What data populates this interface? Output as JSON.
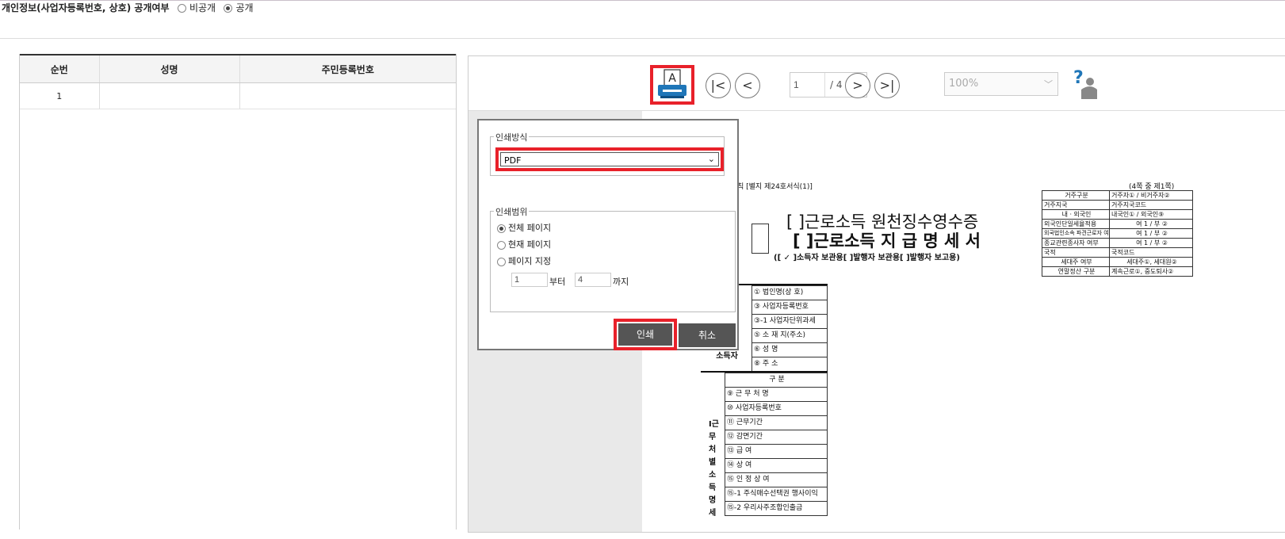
{
  "top": {
    "title": "개인정보(사업자등록번호, 상호) 공개여부",
    "opt_private": "비공개",
    "opt_public": "공개"
  },
  "table": {
    "headers": [
      "순번",
      "성명",
      "주민등록번호"
    ],
    "rows": [
      [
        "1",
        "",
        ""
      ]
    ]
  },
  "viewer": {
    "page_current": "1",
    "page_total": "/ 4",
    "zoom": "100%",
    "print_icon_letter": "A"
  },
  "dialog": {
    "method_legend": "인쇄방식",
    "method_value": "PDF",
    "range_legend": "인쇄범위",
    "opt_all": "전체 페이지",
    "opt_current": "현재 페이지",
    "opt_range": "페이지 지정",
    "from_value": "1",
    "from_label": "부터",
    "to_value": "4",
    "to_label": "까지",
    "print_label": "인쇄",
    "cancel_label": "취소"
  },
  "document": {
    "rule_ref": "칙 [별지 제24호서식(1)]",
    "page_note": "(4쪽 중 제1쪽)",
    "title1": "[  ]근로소득 원천징수영수증",
    "title2": "[  ]근로소득 지 급 명 세 서",
    "subtitle": "([ ✓ ]소득자 보관용[     ]발행자 보관용[     ]발행자 보고용)",
    "right_rows": [
      [
        "거주구분",
        "거주자① / 비거주자②"
      ],
      [
        "거주지국",
        "거주지국코드"
      ],
      [
        "내ㆍ외국인",
        "내국인① / 외국인⑨"
      ],
      [
        "외국인단일세율적용",
        "여 1 / 부 ②"
      ],
      [
        "외국법인소속 파견근로자 여부",
        "여 1 / 부 ②"
      ],
      [
        "종교관련종사자 여부",
        "여 1 / 부 ②"
      ],
      [
        "국적",
        "국적코드"
      ],
      [
        "세대주 여부",
        "세대주①, 세대원②"
      ],
      [
        "연말정산 구분",
        "계속근로①, 중도퇴사②"
      ]
    ],
    "payer_rows": [
      "① 법인명(상 호)",
      "③ 사업자등록번호",
      "③-1 사업자단위과세",
      "⑤ 소 재 지(주소)",
      "⑥ 성    명",
      "⑧ 주    소"
    ],
    "payer_label": "소득자",
    "income_header": "구 분",
    "income_rows": [
      "⑨ 근 무 처 명",
      "⑩ 사업자등록번호",
      "⑪ 근무기간",
      "⑫ 감면기간",
      "⑬ 급     여",
      "⑭ 상     여",
      "⑮ 인 정 상 여",
      "⑮-1 주식매수선택권 행사이익",
      "⑮-2 우리사주조합인출금"
    ],
    "side_label": "Ⅰ근무처별소득명세"
  }
}
